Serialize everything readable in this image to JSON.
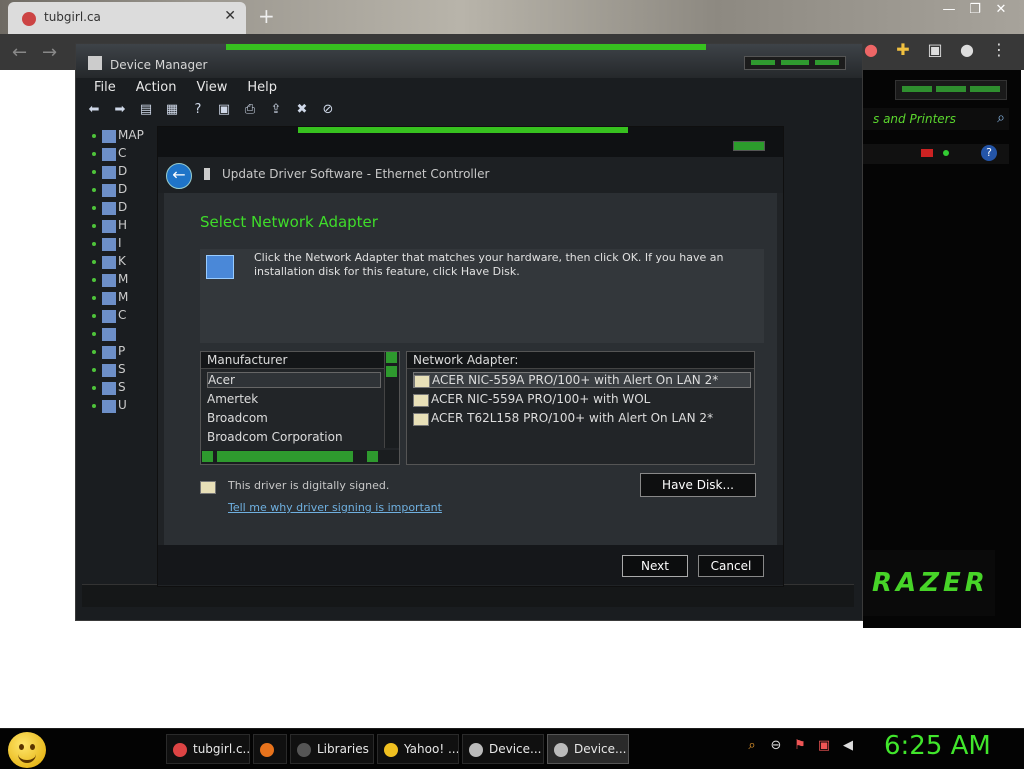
{
  "browser": {
    "tab_title": "tubgirl.ca",
    "tab_close": "✕",
    "new_tab": "+"
  },
  "right_panel": {
    "search_text": "s and Printers",
    "brand": "RAZER"
  },
  "device_manager": {
    "title": "Device Manager",
    "menu": [
      "File",
      "Action",
      "View",
      "Help"
    ],
    "tree": [
      {
        "label": "MAP"
      },
      {
        "label": "C"
      },
      {
        "label": "D"
      },
      {
        "label": "D"
      },
      {
        "label": "D"
      },
      {
        "label": "H"
      },
      {
        "label": "I"
      },
      {
        "label": "K"
      },
      {
        "label": "M"
      },
      {
        "label": "M"
      },
      {
        "label": "C"
      },
      {
        "label": ""
      },
      {
        "label": "P"
      },
      {
        "label": "S"
      },
      {
        "label": "S"
      },
      {
        "label": "U"
      }
    ]
  },
  "dialog": {
    "title": "Update Driver Software - Ethernet Controller",
    "heading": "Select Network Adapter",
    "info": "Click the Network Adapter that matches your hardware, then click OK. If you have an installation disk for this feature, click Have Disk.",
    "manufacturer_header": "Manufacturer",
    "manufacturers": [
      "Acer",
      "Amertek",
      "Broadcom",
      "Broadcom Corporation"
    ],
    "adapter_header": "Network Adapter:",
    "adapters": [
      "ACER NIC-559A PRO/100+ with Alert On LAN 2*",
      "ACER NIC-559A PRO/100+ with WOL",
      "ACER T62L158 PRO/100+ with Alert On LAN 2*"
    ],
    "signed_text": "This driver is digitally signed.",
    "signing_link": "Tell me why driver signing is important",
    "have_disk": "Have Disk...",
    "next": "Next",
    "cancel": "Cancel"
  },
  "taskbar": {
    "items": [
      {
        "label": "tubgirl.c...",
        "color": "#d44"
      },
      {
        "label": "",
        "color": "#e8731c"
      },
      {
        "label": "Libraries",
        "color": "#555"
      },
      {
        "label": "Yahoo! ...",
        "color": "#f0c020"
      },
      {
        "label": "Device...",
        "color": "#bbb"
      },
      {
        "label": "Device...",
        "color": "#bbb"
      }
    ],
    "clock": "6:25 AM"
  },
  "colors": {
    "accent": "#37c11f",
    "heading": "#3fdc2a"
  }
}
